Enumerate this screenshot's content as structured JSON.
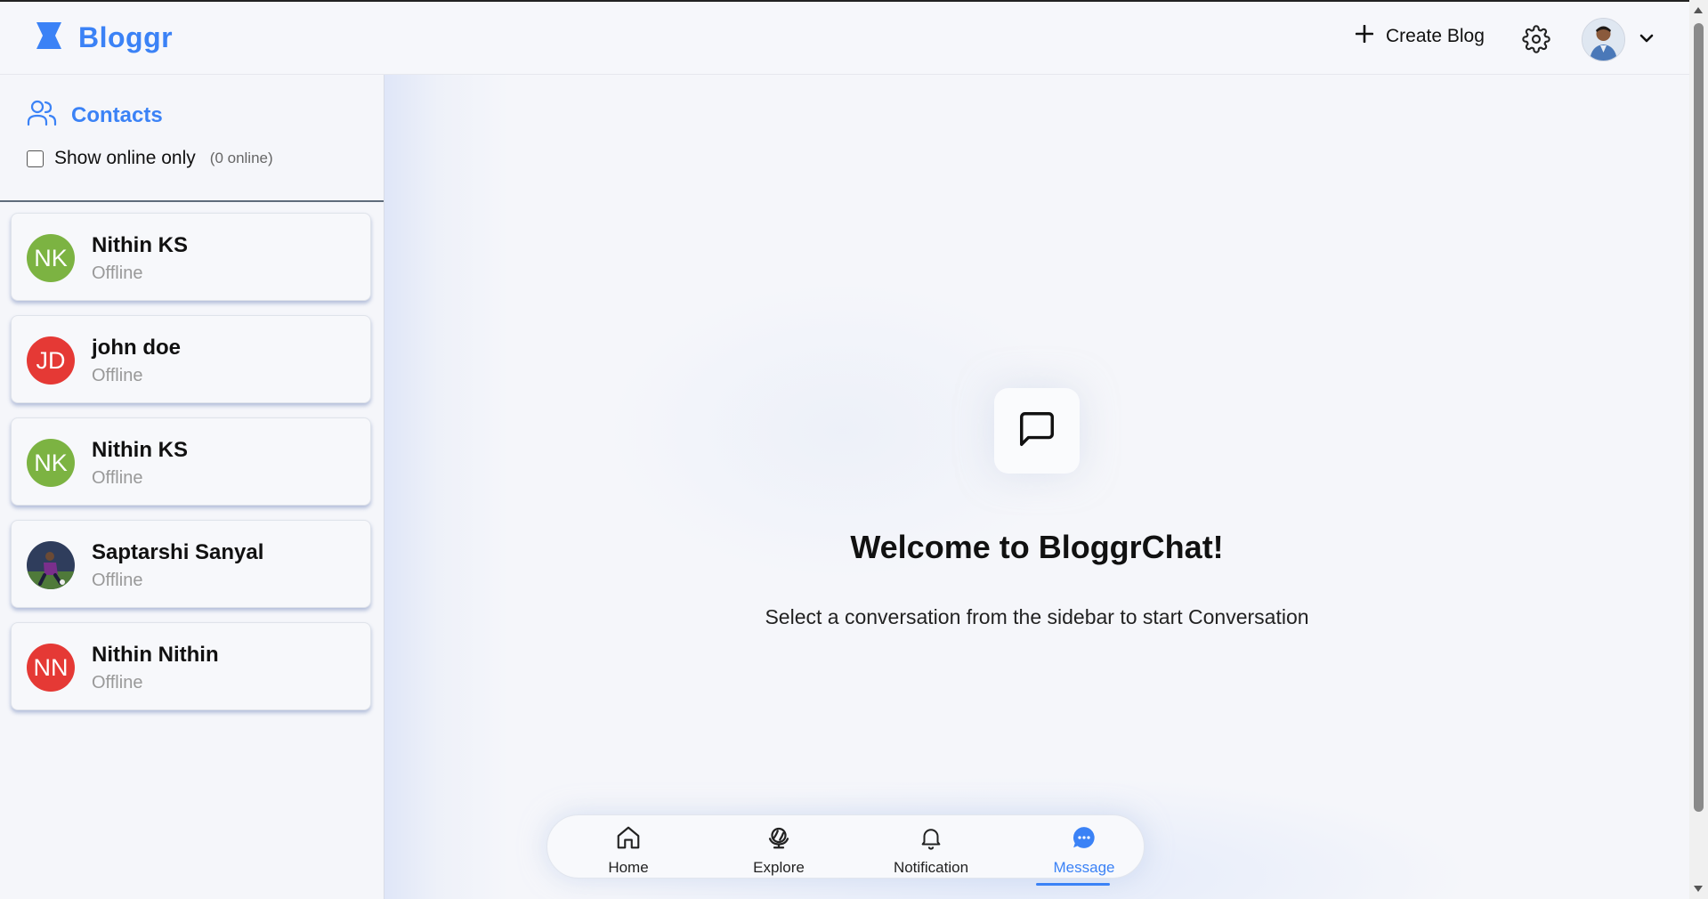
{
  "header": {
    "logo_text": "Bloggr",
    "create_blog_label": "Create Blog",
    "icons": [
      "hourglass-logo-icon",
      "plus-icon",
      "gear-icon",
      "chevron-down-icon"
    ]
  },
  "sidebar": {
    "title": "Contacts",
    "filter_label": "Show online only",
    "online_count": "(0 online)",
    "contacts": [
      {
        "initials": "NK",
        "name": "Nithin KS",
        "status": "Offline",
        "color": "#7cb342"
      },
      {
        "initials": "JD",
        "name": "john doe",
        "status": "Offline",
        "color": "#e53935"
      },
      {
        "initials": "NK",
        "name": "Nithin KS",
        "status": "Offline",
        "color": "#7cb342"
      },
      {
        "initials": "",
        "name": "Saptarshi Sanyal",
        "status": "Offline",
        "color": "#3a4a6a"
      },
      {
        "initials": "NN",
        "name": "Nithin Nithin",
        "status": "Offline",
        "color": "#e53935"
      }
    ]
  },
  "main": {
    "welcome_title": "Welcome to BloggrChat!",
    "welcome_subtitle": "Select a conversation from the sidebar to start Conversation"
  },
  "bottom_nav": {
    "items": [
      {
        "label": "Home",
        "icon": "home-icon"
      },
      {
        "label": "Explore",
        "icon": "globe-icon"
      },
      {
        "label": "Notification",
        "icon": "bell-icon"
      },
      {
        "label": "Message",
        "icon": "chat-bubble-icon"
      }
    ],
    "active": "Message"
  },
  "colors": {
    "accent": "#3b82f6",
    "green_avatar": "#7cb342",
    "red_avatar": "#e53935"
  }
}
